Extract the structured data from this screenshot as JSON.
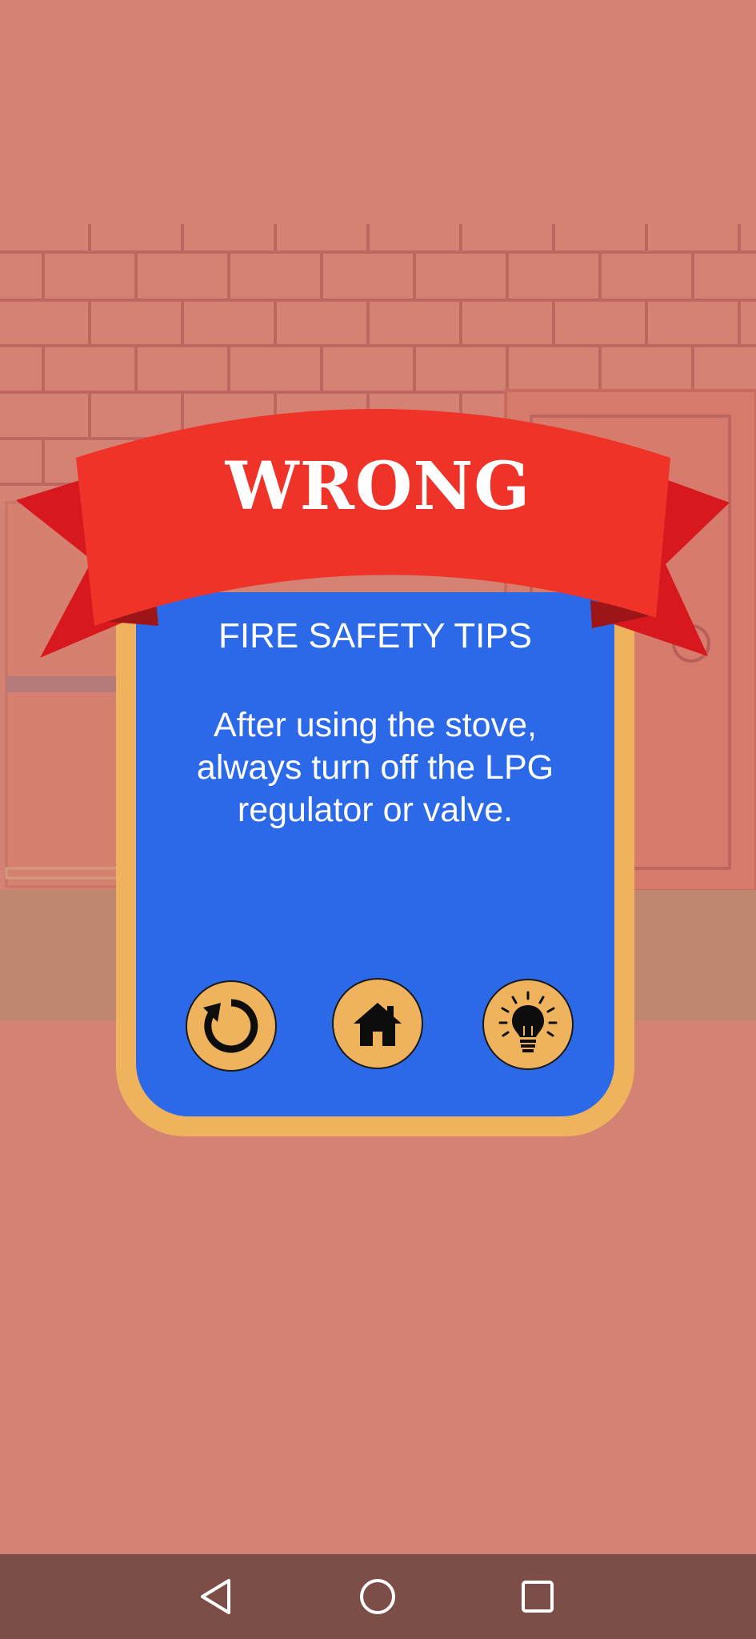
{
  "banner": {
    "title": "WRONG"
  },
  "tips": {
    "heading": "FIRE SAFETY TIPS",
    "message": "After using the stove, always turn off the LPG regulator or valve."
  },
  "actions": [
    {
      "name": "retry",
      "icon": "refresh-icon"
    },
    {
      "name": "home",
      "icon": "home-icon"
    },
    {
      "name": "hint",
      "icon": "lightbulb-icon"
    }
  ],
  "navigation": {
    "back": "back-triangle-icon",
    "home": "home-circle-icon",
    "recents": "recents-square-icon"
  },
  "colors": {
    "background": "#d48274",
    "ribbon": "#ef3328",
    "panel": "#2b69e8",
    "panel_border": "#efb35e",
    "nav_bar": "#7d4e47"
  }
}
